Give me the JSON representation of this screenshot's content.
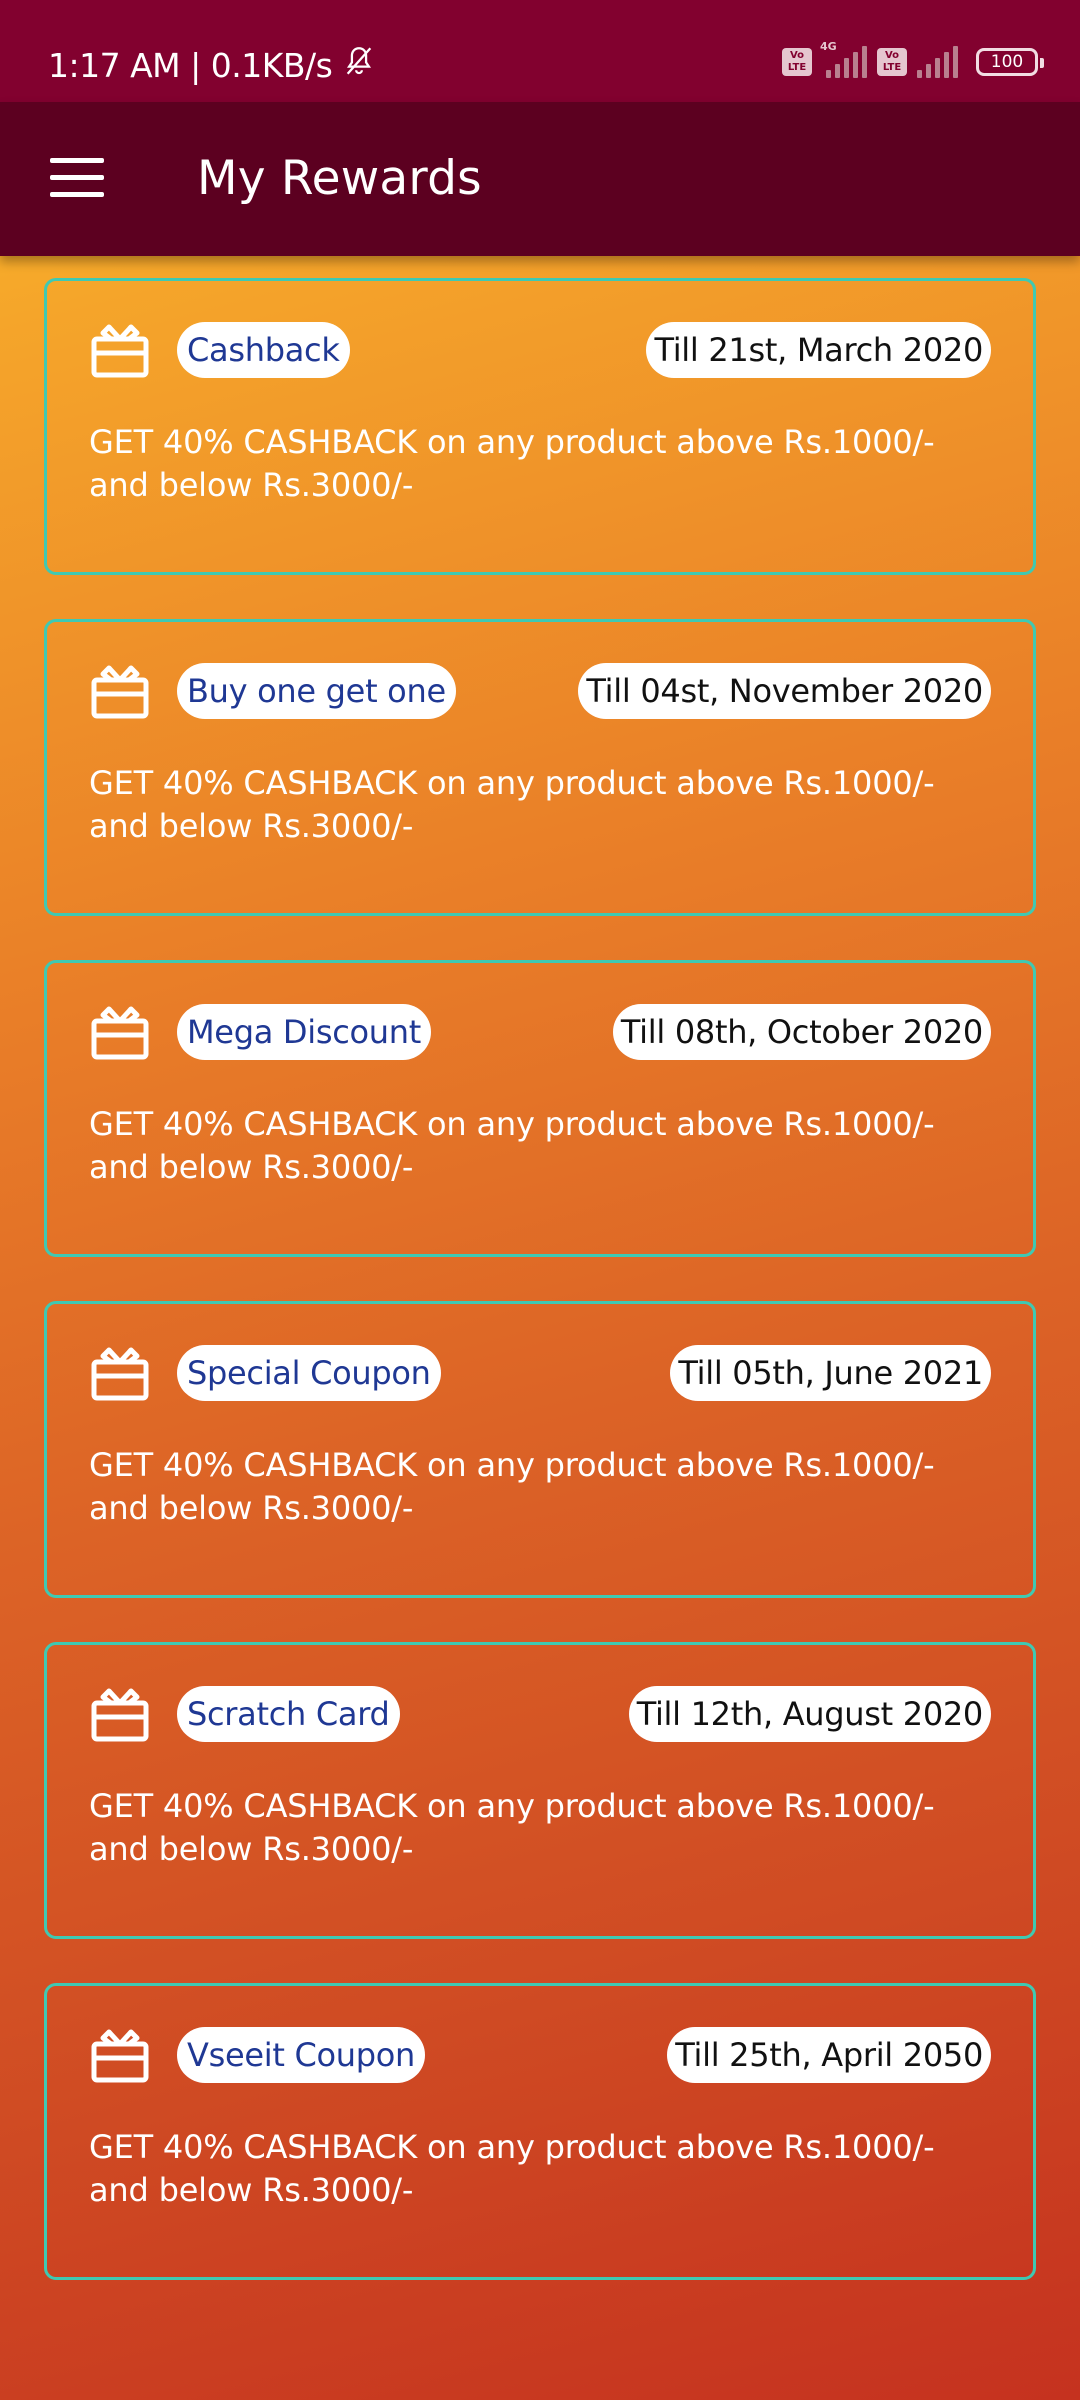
{
  "status_bar": {
    "time": "1:17 AM",
    "separator": "|",
    "speed": "0.1KB/s",
    "volte1": "Vo LTE",
    "network_tag": "4G",
    "volte2": "Vo LTE",
    "battery": "100",
    "icons": [
      "bell-off-icon",
      "volte-icon",
      "signal-icon",
      "volte-icon",
      "signal-icon",
      "battery-icon"
    ]
  },
  "app_bar": {
    "title": "My Rewards",
    "menu_icon": "hamburger-menu-icon"
  },
  "colors": {
    "status_bar": "#82012f",
    "app_bar": "#5c0020",
    "card_border": "#3fc9b2",
    "name_text": "#1f3894",
    "gradient_top": "#fbbf2a",
    "gradient_bottom": "#c5321f"
  },
  "rewards": [
    {
      "name": "Cashback",
      "date": "Till 21st, March 2020",
      "description": "GET 40% CASHBACK on any product above Rs.1000/- and below Rs.3000/-",
      "icon": "gift-card-icon"
    },
    {
      "name": "Buy one get one",
      "date": "Till 04st, November 2020",
      "description": "GET 40% CASHBACK on any product above Rs.1000/- and below Rs.3000/-",
      "icon": "gift-card-icon"
    },
    {
      "name": "Mega Discount",
      "date": "Till 08th, October 2020",
      "description": "GET 40% CASHBACK on any product above Rs.1000/- and below Rs.3000/-",
      "icon": "gift-card-icon"
    },
    {
      "name": "Special Coupon",
      "date": "Till 05th, June 2021",
      "description": "GET 40% CASHBACK on any product above Rs.1000/- and below Rs.3000/-",
      "icon": "gift-card-icon"
    },
    {
      "name": "Scratch Card",
      "date": "Till 12th, August 2020",
      "description": "GET 40% CASHBACK on any product above Rs.1000/- and below Rs.3000/-",
      "icon": "gift-card-icon"
    },
    {
      "name": "Vseeit Coupon",
      "date": "Till 25th, April 2050",
      "description": "GET 40% CASHBACK on any product above Rs.1000/- and below Rs.3000/-",
      "icon": "gift-card-icon"
    }
  ]
}
